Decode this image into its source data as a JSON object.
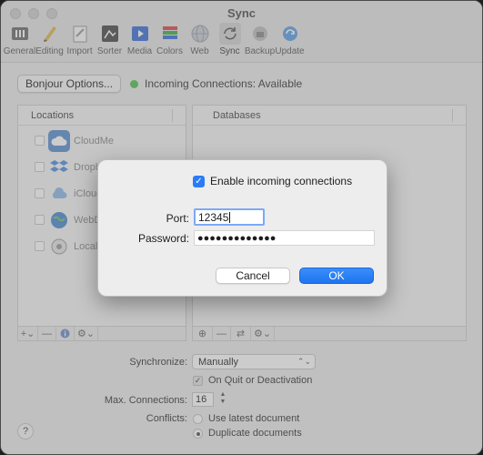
{
  "window": {
    "title": "Sync"
  },
  "toolbar": {
    "items": [
      {
        "label": "General",
        "icon": "general-icon",
        "color": "#6d6d6d"
      },
      {
        "label": "Editing",
        "icon": "pencil-icon",
        "color": "#e0b94a"
      },
      {
        "label": "Import",
        "icon": "import-icon",
        "color": "#9a9a9a"
      },
      {
        "label": "Sorter",
        "icon": "sorter-icon",
        "color": "#4a4a4a"
      },
      {
        "label": "Media",
        "icon": "media-icon",
        "color": "#3a6fd8"
      },
      {
        "label": "Colors",
        "icon": "colors-icon",
        "color": "#d94a4a"
      },
      {
        "label": "Web",
        "icon": "globe-icon",
        "color": "#9aa3ad"
      },
      {
        "label": "Sync",
        "icon": "sync-icon",
        "color": "#6d6d6d"
      },
      {
        "label": "Backup",
        "icon": "backup-icon",
        "color": "#8a8a8a"
      },
      {
        "label": "Update",
        "icon": "update-icon",
        "color": "#5c9ee6"
      }
    ]
  },
  "bonjour": {
    "button_label": "Bonjour Options...",
    "status_text": "Incoming Connections: Available",
    "status_color": "#4fc24f"
  },
  "locations": {
    "header": "Locations",
    "items": [
      {
        "label": "CloudMe",
        "icon": "cloudme-icon"
      },
      {
        "label": "Dropb",
        "icon": "dropbox-icon"
      },
      {
        "label": "iCloud",
        "icon": "icloud-icon"
      },
      {
        "label": "WebD",
        "icon": "webdav-icon"
      },
      {
        "label": "Local",
        "icon": "local-folder-icon"
      }
    ]
  },
  "databases": {
    "header": "Databases"
  },
  "settings": {
    "synchronize_label": "Synchronize:",
    "synchronize_value": "Manually",
    "on_quit_label": "On Quit or Deactivation",
    "max_connections_label": "Max. Connections:",
    "max_connections_value": "16",
    "conflicts_label": "Conflicts:",
    "conflict_options": [
      "Use latest document",
      "Duplicate documents"
    ],
    "conflict_selected": "Duplicate documents"
  },
  "help": {
    "label": "?"
  },
  "dialog": {
    "enable_label": "Enable incoming connections",
    "enable_checked": true,
    "port_label": "Port:",
    "port_value": "12345",
    "password_label": "Password:",
    "password_value": "●●●●●●●●●●●●●",
    "cancel_label": "Cancel",
    "ok_label": "OK",
    "accent_color": "#2a7cf6"
  }
}
